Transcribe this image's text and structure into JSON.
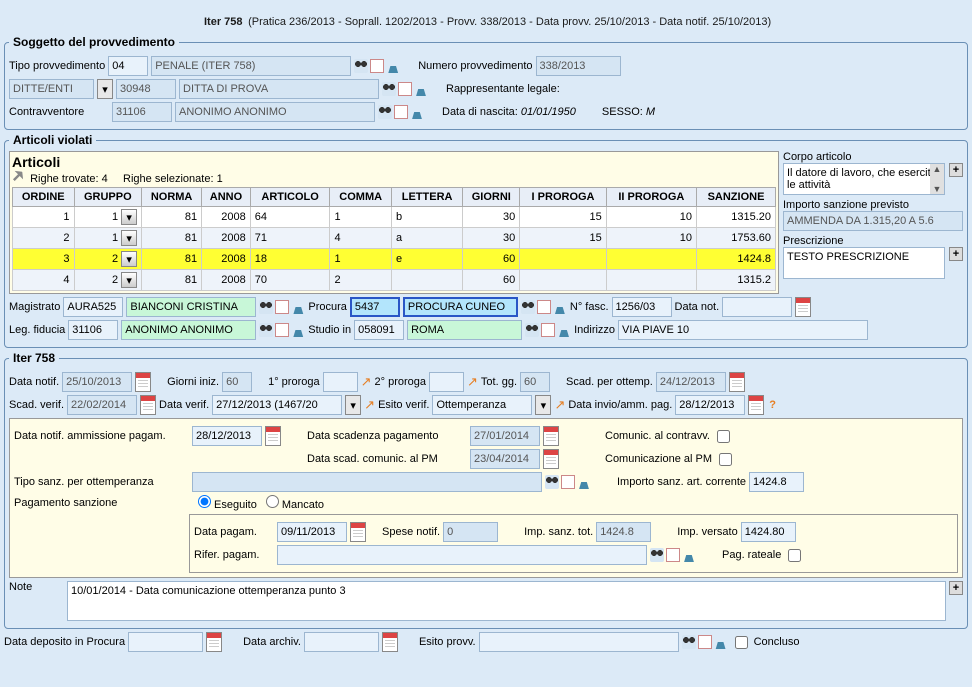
{
  "title": "Iter 758",
  "subtitle": "(Pratica 236/2013 - Soprall. 1202/2013 - Provv. 338/2013 - Data provv. 25/10/2013 - Data notif. 25/10/2013)",
  "soggetto": {
    "legend": "Soggetto del provvedimento",
    "tipo_provv_lbl": "Tipo provvedimento",
    "tipo_provv_code": "04",
    "tipo_provv_desc": "PENALE (ITER 758)",
    "num_provv_lbl": "Numero provvedimento",
    "num_provv": "338/2013",
    "ditte_label": "DITTE/ENTI",
    "ditte_code": "30948",
    "ditte_desc": "DITTA DI PROVA",
    "rappr_lbl": "Rappresentante legale:",
    "contr_lbl": "Contravventore",
    "contr_code": "31106",
    "contr_desc": "ANONIMO ANONIMO",
    "nascita_lbl": "Data di nascita:",
    "nascita": "01/01/1950",
    "sesso_lbl": "SESSO:",
    "sesso": "M"
  },
  "articoli": {
    "legend": "Articoli violati",
    "gridtitle": "Articoli",
    "righe_trovate_lbl": "Righe trovate:",
    "righe_trovate": "4",
    "righe_sel_lbl": "Righe selezionate:",
    "righe_sel": "1",
    "cols": [
      "ORDINE",
      "GRUPPO",
      "NORMA",
      "ANNO",
      "ARTICOLO",
      "COMMA",
      "LETTERA",
      "GIORNI",
      "I PROROGA",
      "II PROROGA",
      "SANZIONE"
    ],
    "rows": [
      {
        "ordine": "1",
        "gruppo": "1",
        "norma": "81",
        "anno": "2008",
        "articolo": "64",
        "comma": "1",
        "lettera": "b",
        "giorni": "30",
        "p1": "15",
        "p2": "10",
        "sanzione": "1315.20"
      },
      {
        "ordine": "2",
        "gruppo": "1",
        "norma": "81",
        "anno": "2008",
        "articolo": "71",
        "comma": "4",
        "lettera": "a",
        "giorni": "30",
        "p1": "15",
        "p2": "10",
        "sanzione": "1753.60"
      },
      {
        "ordine": "3",
        "gruppo": "2",
        "norma": "81",
        "anno": "2008",
        "articolo": "18",
        "comma": "1",
        "lettera": "e",
        "giorni": "60",
        "p1": "",
        "p2": "",
        "sanzione": "1424.8"
      },
      {
        "ordine": "4",
        "gruppo": "2",
        "norma": "81",
        "anno": "2008",
        "articolo": "70",
        "comma": "2",
        "lettera": "",
        "giorni": "60",
        "p1": "",
        "p2": "",
        "sanzione": "1315.2"
      }
    ],
    "corpo_lbl": "Corpo articolo",
    "corpo_txt": "Il datore di lavoro, che esercita le attività",
    "importo_prev_lbl": "Importo sanzione previsto",
    "importo_prev": "AMMENDA DA 1.315,20 A 5.6",
    "prescr_lbl": "Prescrizione",
    "prescr": "TESTO PRESCRIZIONE"
  },
  "ref": {
    "magistrato_lbl": "Magistrato",
    "magistrato_code": "AURA525",
    "magistrato_name": "BIANCONI CRISTINA",
    "procura_lbl": "Procura",
    "procura_code": "5437",
    "procura_name": "PROCURA CUNEO",
    "nfasc_lbl": "N° fasc.",
    "nfasc": "1256/03",
    "datanot_lbl": "Data not.",
    "datanot": "",
    "legfid_lbl": "Leg. fiducia",
    "legfid_code": "31106",
    "legfid_name": "ANONIMO ANONIMO",
    "studio_lbl": "Studio in",
    "studio_code": "058091",
    "studio_name": "ROMA",
    "indirizzo_lbl": "Indirizzo",
    "indirizzo": "VIA PIAVE 10"
  },
  "iter": {
    "legend": "Iter 758",
    "datanotif_lbl": "Data notif.",
    "datanotif": "25/10/2013",
    "giorni_lbl": "Giorni iniz.",
    "giorni": "60",
    "p1_lbl": "1° proroga",
    "p1": "",
    "p2_lbl": "2° proroga",
    "p2": "",
    "tot_lbl": "Tot. gg.",
    "tot": "60",
    "scadott_lbl": "Scad. per ottemp.",
    "scadott": "24/12/2013",
    "scadverif_lbl": "Scad. verif.",
    "scadverif": "22/02/2014",
    "dataverif_lbl": "Data verif.",
    "dataverif": "27/12/2013 (1467/20",
    "esitoverif_lbl": "Esito verif.",
    "esitoverif": "Ottemperanza",
    "datainvio_lbl": "Data invio/amm. pag.",
    "datainvio": "28/12/2013",
    "block": {
      "datanotif_amm_lbl": "Data notif. ammissione pagam.",
      "datanotif_amm": "28/12/2013",
      "datascad_pag_lbl": "Data scadenza pagamento",
      "datascad_pag": "27/01/2014",
      "datascad_pm_lbl": "Data scad. comunic. al PM",
      "datascad_pm": "23/04/2014",
      "comcontr_lbl": "Comunic. al contravv.",
      "compm_lbl": "Comunicazione al PM",
      "tiposanz_lbl": "Tipo sanz. per ottemperanza",
      "tiposanz": "",
      "impsanz_lbl": "Importo sanz. art. corrente",
      "impsanz": "1424.8",
      "pagsanz_lbl": "Pagamento sanzione",
      "eseguito": "Eseguito",
      "mancato": "Mancato",
      "datapagam_lbl": "Data pagam.",
      "datapagam": "09/11/2013",
      "spese_lbl": "Spese notif.",
      "spese": "0",
      "impsanztot_lbl": "Imp. sanz. tot.",
      "impsanztot": "1424.8",
      "impversato_lbl": "Imp. versato",
      "impversato": "1424.80",
      "rifer_lbl": "Rifer. pagam.",
      "rifer": "",
      "pagrat_lbl": "Pag. rateale"
    }
  },
  "note_lbl": "Note",
  "note": "10/01/2014 - Data comunicazione ottemperanza punto 3",
  "footer": {
    "dep_lbl": "Data deposito in Procura",
    "dep": "",
    "arch_lbl": "Data archiv.",
    "arch": "",
    "esito_lbl": "Esito provv.",
    "esito": "",
    "concluso_lbl": "Concluso"
  }
}
